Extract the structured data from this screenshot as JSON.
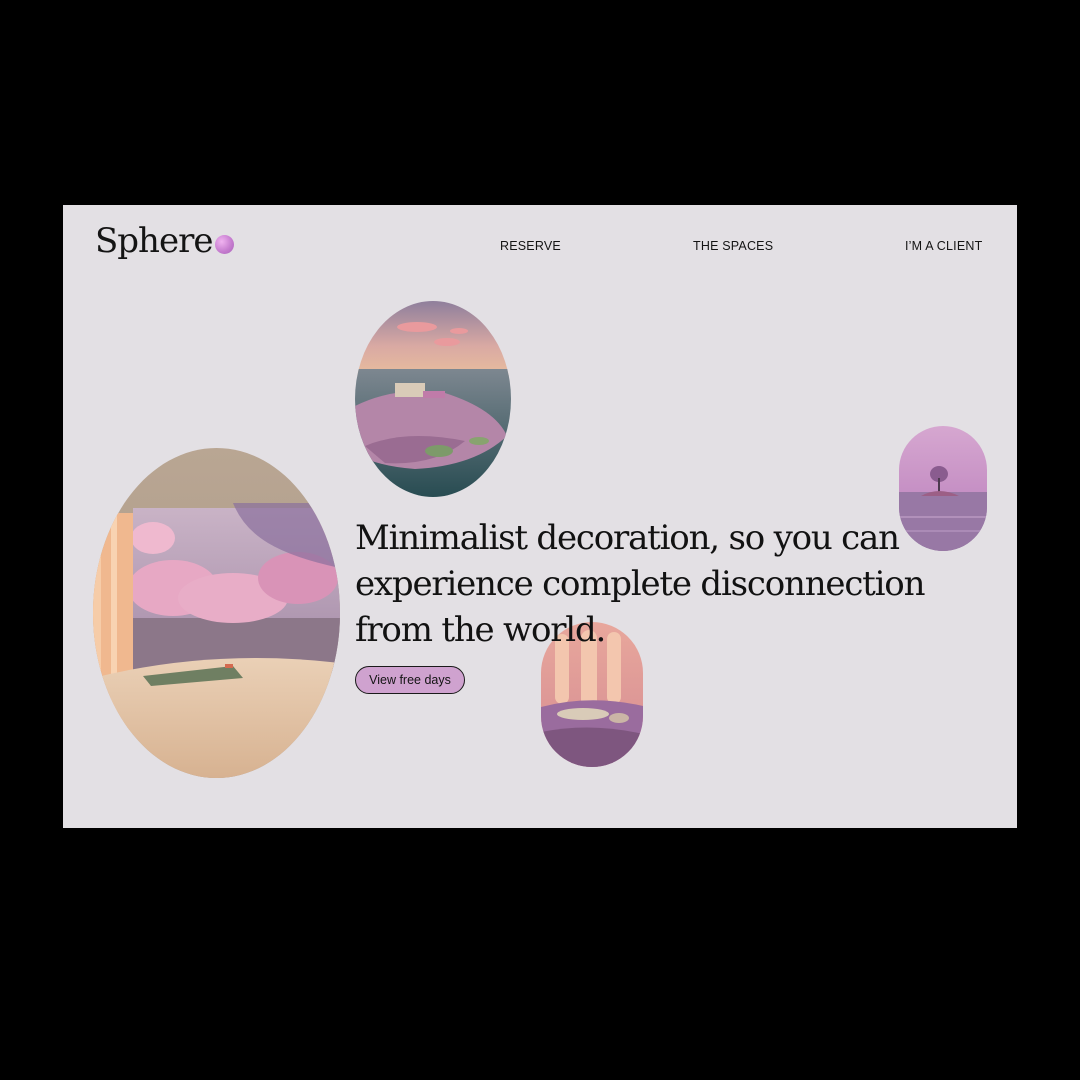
{
  "brand": {
    "name": "Sphere",
    "dot_color": "#c77ed0"
  },
  "nav": {
    "reserve": "RESERVE",
    "spaces": "THE SPACES",
    "client": "I’M A CLIENT"
  },
  "hero": {
    "headline": "Minimalist decoration, so you can experience complete disconnection from the world.",
    "cta": "View free days"
  },
  "colors": {
    "background": "#e3e0e4",
    "button": "#cfa2cf",
    "text": "#141414"
  }
}
